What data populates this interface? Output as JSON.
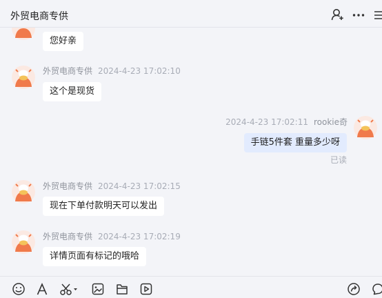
{
  "header": {
    "title": "外贸电商专供",
    "icons": [
      "add-user-icon",
      "more-icon",
      "menu-icon"
    ]
  },
  "messages": [
    {
      "sender": "",
      "time": "",
      "text": "您好亲",
      "side": "left"
    },
    {
      "sender": "外贸电商专供",
      "time": "2024-4-23 17:02:10",
      "text": "这个是现货",
      "side": "left"
    },
    {
      "sender": "rookie奇",
      "time": "2024-4-23 17:02:11",
      "text": "手链5件套  重量多少呀",
      "side": "right",
      "status": "已读"
    },
    {
      "sender": "外贸电商专供",
      "time": "2024-4-23 17:02:15",
      "text": "现在下单付款明天可以发出",
      "side": "left"
    },
    {
      "sender": "外贸电商专供",
      "time": "2024-4-23 17:02:19",
      "text": "详情页面有标记的哦哈",
      "side": "left"
    }
  ],
  "toolbar": {
    "icons": [
      "emoji-icon",
      "font-icon",
      "scissors-icon",
      "image-icon",
      "file-icon",
      "video-icon",
      "send-icon",
      "chat-icon"
    ]
  },
  "colors": {
    "background": "#f3f4f8",
    "bubble_other": "#ffffff",
    "bubble_mine": "#e2ebfe",
    "avatar_orange": "#f07a4b",
    "meta_text": "#a8acb6"
  }
}
